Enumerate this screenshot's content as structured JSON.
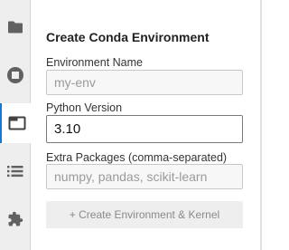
{
  "sidebar": {
    "items": [
      {
        "icon": "folder-icon"
      },
      {
        "icon": "stop-circle-icon"
      },
      {
        "icon": "tab-icon"
      },
      {
        "icon": "list-icon"
      },
      {
        "icon": "extension-puzzle-icon"
      }
    ],
    "active_index": 2,
    "accent_color": "#1976d2"
  },
  "panel": {
    "title": "Create Conda Environment",
    "env_name": {
      "label": "Environment Name",
      "value": "",
      "placeholder": "my-env"
    },
    "python_version": {
      "label": "Python Version",
      "value": "3.10"
    },
    "extra_packages": {
      "label": "Extra Packages (comma-separated)",
      "value": "",
      "placeholder": "numpy, pandas, scikit-learn"
    },
    "create_button_label": "+ Create Environment & Kernel"
  }
}
